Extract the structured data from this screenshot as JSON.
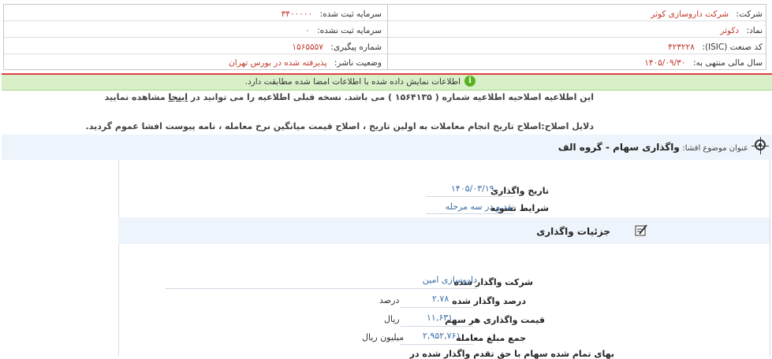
{
  "header": {
    "company_label": "شرکت:",
    "company_value": "شرکت داروسازی کوثر",
    "symbol_label": "نماد:",
    "symbol_value": "دکوثر",
    "isic_label": "کد صنعت (ISIC):",
    "isic_value": "۴۲۳۲۲۸",
    "fiscal_label": "سال مالی منتهی به:",
    "fiscal_value": "۱۴۰۵/۰۹/۳۰",
    "reg_capital_label": "سرمایه ثبت شده:",
    "reg_capital_value": "۳۴۰۰۰۰۰",
    "unreg_capital_label": "سرمایه ثبت نشده:",
    "unreg_capital_value": "۰",
    "tracking_label": "شماره پیگیری:",
    "tracking_value": "۱۵۶۵۵۵۷",
    "status_label": "وضعیت ناشر:",
    "status_value": "پذیرفته شده در بورس تهران"
  },
  "notice": {
    "info_text": "اطلاعات نمایش داده شده با اطلاعات امضا شده مطابقت دارد.",
    "correction_text_before": "این اطلاعیه اصلاحیه اطلاعیه شماره ( ۱۵۶۴۱۳۵ ) می باشد. نسخه قبلی اطلاعیه را می توانید در",
    "correction_link": "اینجا",
    "correction_text_after": "مشاهده نمایید",
    "reasons": "دلایل اصلاح:اصلاح تاریخ انجام معاملات به اولین تاریخ ، اصلاح قیمت میانگین نرخ معامله ، نامه پیوست افشا عموم گردید."
  },
  "topic": {
    "label": "عنوان موضوع افشا:",
    "value": "واگذاری سهام - گروه الف"
  },
  "summary": {
    "date_label": "تاریخ واگذاری",
    "date_value": "۱۴۰۵/۰۳/۱۹",
    "terms_label": "شرایط تسویه",
    "terms_value": "نقد و در سه مرحله"
  },
  "details": {
    "section_title": "جزئیات واگذاری",
    "company_label": "شرکت واگذار شده",
    "company_value": "داروسازی امین",
    "percent_label": "درصد واگذار شده",
    "percent_value": "۲.۷۸",
    "percent_unit": "درصد",
    "price_label": "قیمت واگذاری هر سهم",
    "price_value": "۱۱,۶۳۱",
    "price_unit": "ریال",
    "total_label": "جمع مبلغ معامله",
    "total_value": "۲,۹۵۲,۷۶۱",
    "total_unit": "میلیون ریال",
    "cutoff_label": "بهای تمام شده سهام با حق تقدم واگذار شده در"
  }
}
